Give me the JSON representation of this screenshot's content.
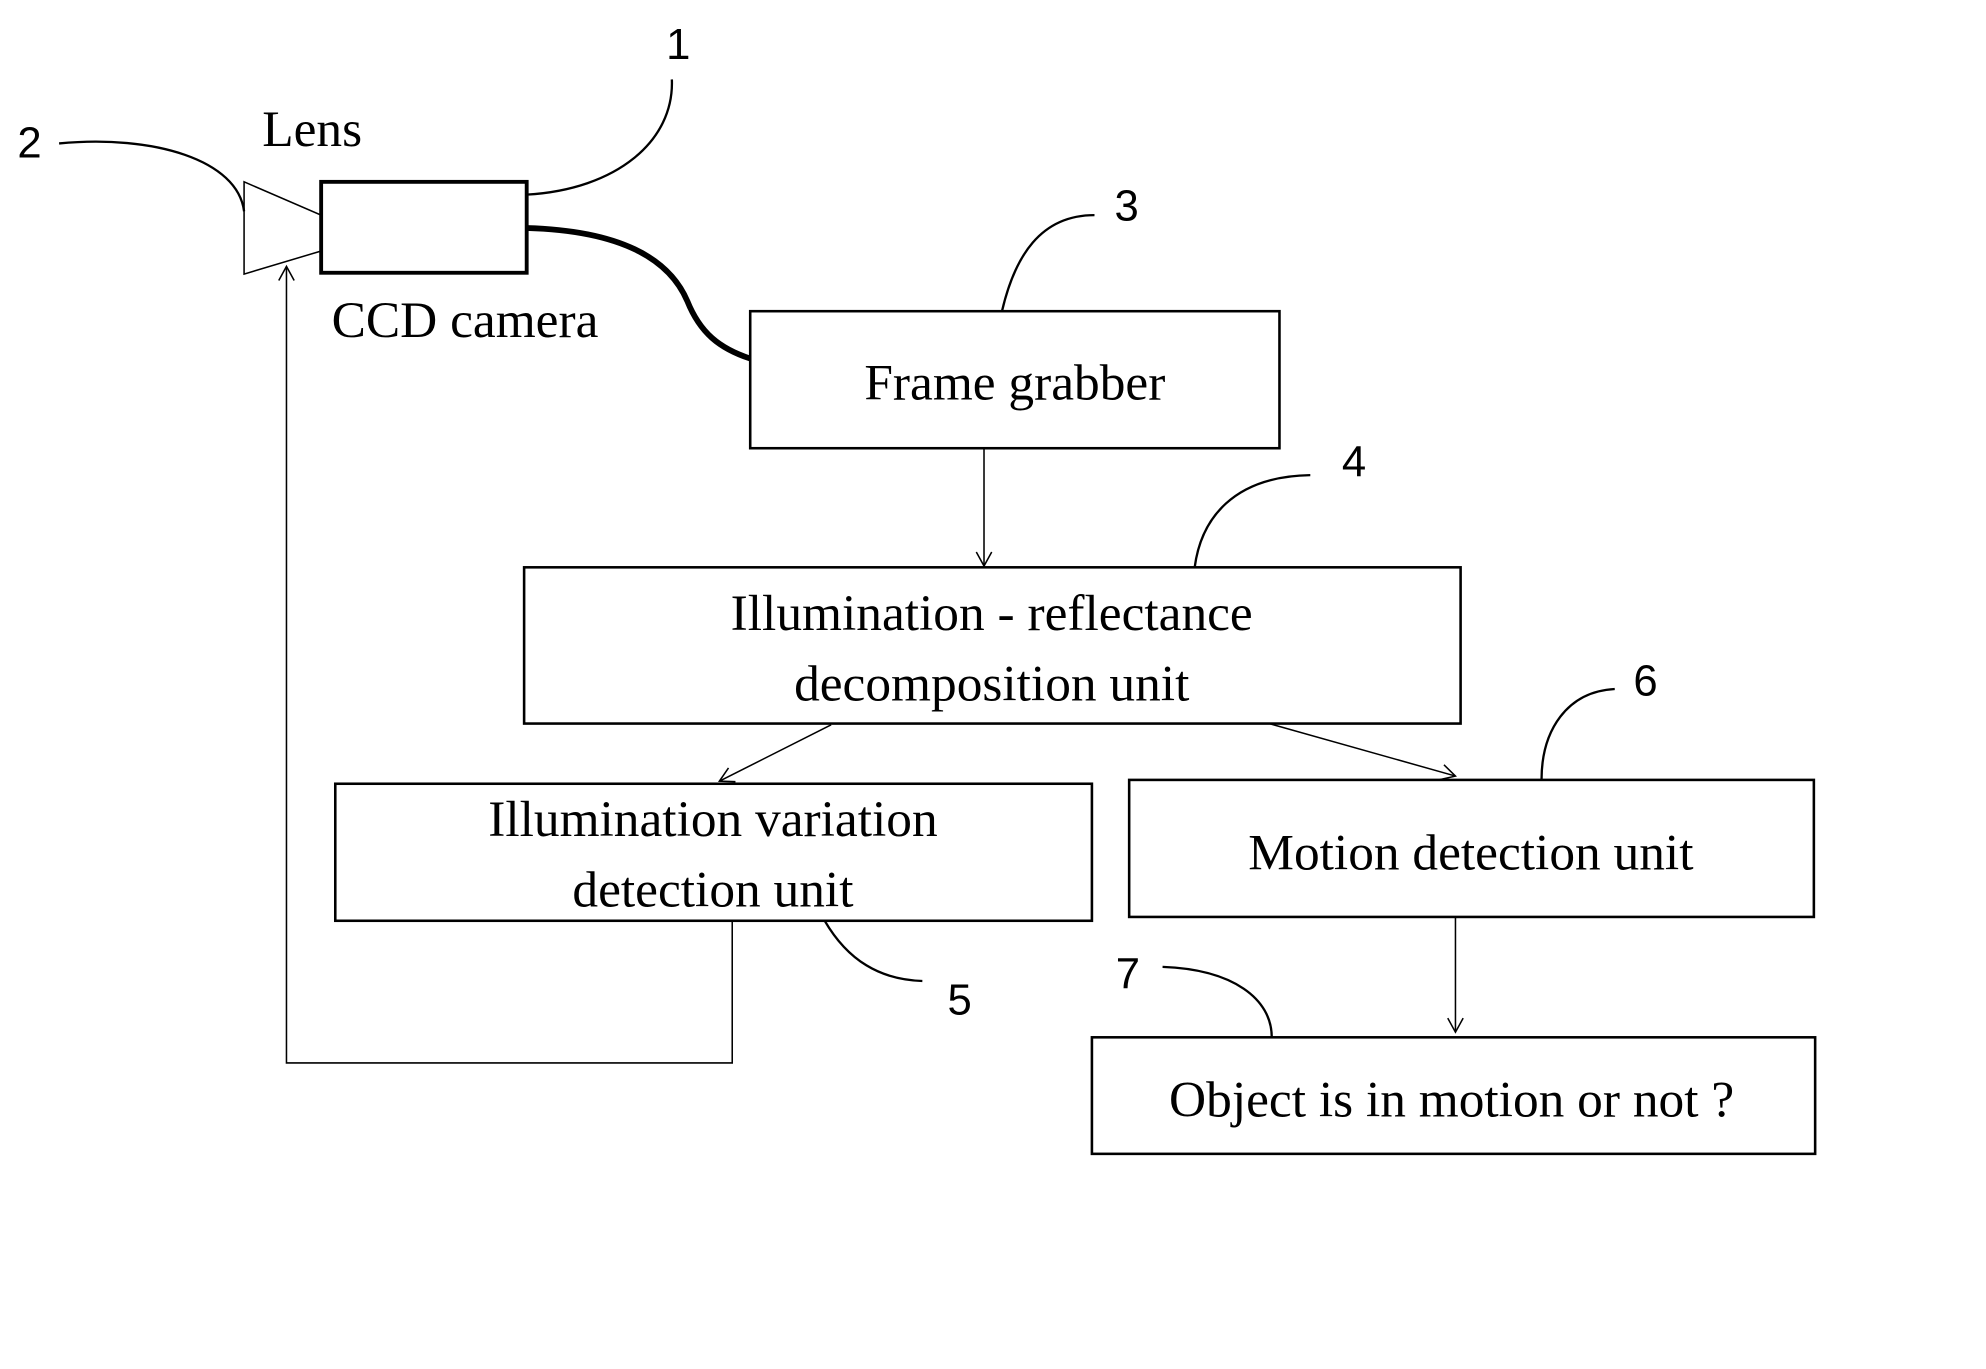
{
  "labels": {
    "lens": "Lens",
    "camera": "CCD camera"
  },
  "boxes": {
    "frame_grabber": "Frame grabber",
    "decomposition": [
      "Illumination - reflectance",
      "decomposition unit"
    ],
    "illum_variation": [
      "Illumination variation",
      "detection unit"
    ],
    "motion_detection": "Motion detection unit",
    "result": "Object is in motion or not ?"
  },
  "reference_numerals": {
    "camera": "1",
    "lens": "2",
    "frame_grabber": "3",
    "decomposition": "4",
    "illum_variation": "5",
    "motion_detection": "6",
    "result": "7"
  }
}
